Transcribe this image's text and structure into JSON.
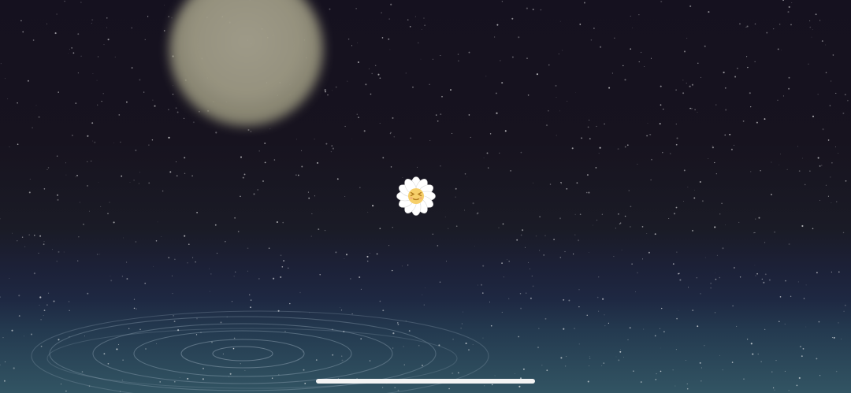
{
  "scene": {
    "type": "night-sky-water",
    "colors": {
      "sky_top": "#15111f",
      "horizon": "#1c2036",
      "water": "#2d4b5c",
      "moon": "#a6a28c",
      "ripple": "#8fa3b3",
      "petal": "#ffffff",
      "flower_center": "#f6cf6a"
    }
  },
  "moon": {
    "icon": "moon",
    "blurred": true
  },
  "character": {
    "icon": "daisy-flower-face",
    "expression": "squinting-eyes"
  },
  "water_ripples": {
    "ring_count": 7
  },
  "system": {
    "home_indicator": true
  }
}
